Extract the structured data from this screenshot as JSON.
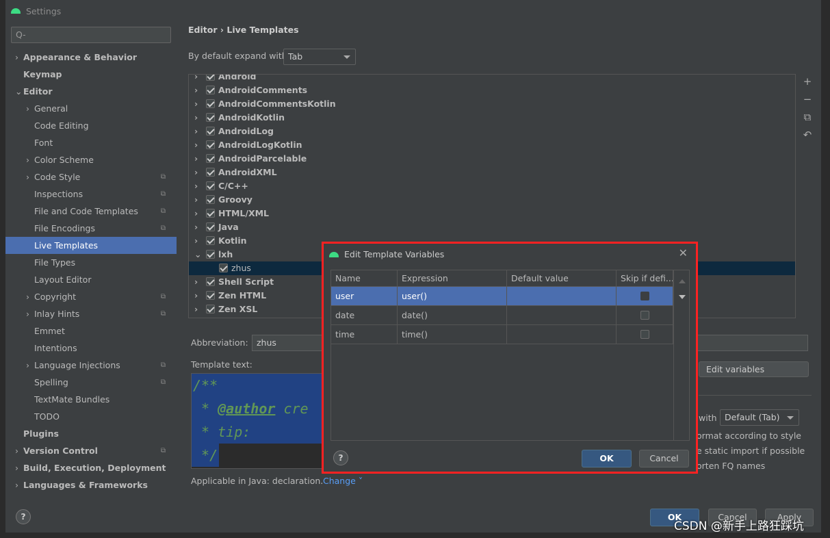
{
  "window": {
    "title": "Settings"
  },
  "search": {
    "placeholder": "Q-"
  },
  "sidebar": {
    "items": [
      {
        "label": "Appearance & Behavior",
        "level": 0,
        "bold": true,
        "chevron": "right"
      },
      {
        "label": "Keymap",
        "level": 0,
        "bold": true
      },
      {
        "label": "Editor",
        "level": 0,
        "bold": true,
        "chevron": "down"
      },
      {
        "label": "General",
        "level": 1,
        "chevron": "right"
      },
      {
        "label": "Code Editing",
        "level": 1
      },
      {
        "label": "Font",
        "level": 1
      },
      {
        "label": "Color Scheme",
        "level": 1,
        "chevron": "right"
      },
      {
        "label": "Code Style",
        "level": 1,
        "chevron": "right",
        "copy": true
      },
      {
        "label": "Inspections",
        "level": 1,
        "copy": true
      },
      {
        "label": "File and Code Templates",
        "level": 1,
        "copy": true
      },
      {
        "label": "File Encodings",
        "level": 1,
        "copy": true
      },
      {
        "label": "Live Templates",
        "level": 1,
        "selected": true
      },
      {
        "label": "File Types",
        "level": 1
      },
      {
        "label": "Layout Editor",
        "level": 1
      },
      {
        "label": "Copyright",
        "level": 1,
        "chevron": "right",
        "copy": true
      },
      {
        "label": "Inlay Hints",
        "level": 1,
        "chevron": "right",
        "copy": true
      },
      {
        "label": "Emmet",
        "level": 1
      },
      {
        "label": "Intentions",
        "level": 1
      },
      {
        "label": "Language Injections",
        "level": 1,
        "chevron": "right",
        "copy": true
      },
      {
        "label": "Spelling",
        "level": 1,
        "copy": true
      },
      {
        "label": "TextMate Bundles",
        "level": 1
      },
      {
        "label": "TODO",
        "level": 1
      },
      {
        "label": "Plugins",
        "level": 0,
        "bold": true
      },
      {
        "label": "Version Control",
        "level": 0,
        "bold": true,
        "chevron": "right",
        "copy": true
      },
      {
        "label": "Build, Execution, Deployment",
        "level": 0,
        "bold": true,
        "chevron": "right"
      },
      {
        "label": "Languages & Frameworks",
        "level": 0,
        "bold": true,
        "chevron": "right"
      }
    ]
  },
  "breadcrumb": {
    "parent": "Editor",
    "sep": "›",
    "current": "Live Templates"
  },
  "expand": {
    "label": "By default expand with",
    "value": "Tab"
  },
  "tree": [
    {
      "label": "Android",
      "chevron": "right"
    },
    {
      "label": "AndroidComments",
      "chevron": "right"
    },
    {
      "label": "AndroidCommentsKotlin",
      "chevron": "right"
    },
    {
      "label": "AndroidKotlin",
      "chevron": "right"
    },
    {
      "label": "AndroidLog",
      "chevron": "right"
    },
    {
      "label": "AndroidLogKotlin",
      "chevron": "right"
    },
    {
      "label": "AndroidParcelable",
      "chevron": "right"
    },
    {
      "label": "AndroidXML",
      "chevron": "right"
    },
    {
      "label": "C/C++",
      "chevron": "right"
    },
    {
      "label": "Groovy",
      "chevron": "right"
    },
    {
      "label": "HTML/XML",
      "chevron": "right"
    },
    {
      "label": "Java",
      "chevron": "right"
    },
    {
      "label": "Kotlin",
      "chevron": "right"
    },
    {
      "label": "lxh",
      "chevron": "down"
    },
    {
      "label": "zhus",
      "child": true,
      "selected": true
    },
    {
      "label": "Shell Script",
      "chevron": "right"
    },
    {
      "label": "Zen HTML",
      "chevron": "right"
    },
    {
      "label": "Zen XSL",
      "chevron": "right"
    }
  ],
  "tools": [
    "+",
    "−",
    "⧉",
    "↶"
  ],
  "abbreviation": {
    "label": "Abbreviation:",
    "value": "zhus"
  },
  "template": {
    "label": "Template text:",
    "lines": [
      "/**",
      " * ",
      "@author",
      " cre",
      " * tip:",
      " */"
    ]
  },
  "applicable": {
    "text": "Applicable in Java: declaration.",
    "change": "Change"
  },
  "options": {
    "edit_variables": "Edit variables",
    "expand_with": "with",
    "expand_value": "Default (Tab)",
    "reformat": "ormat according to style",
    "static_import": "e static import if possible",
    "shorten": "orten FQ names"
  },
  "buttons": {
    "ok": "OK",
    "cancel": "Cancel",
    "apply": "Apply",
    "help": "?"
  },
  "dialog": {
    "title": "Edit Template Variables",
    "close": "✕",
    "columns": [
      "Name",
      "Expression",
      "Default value",
      "Skip if defi..."
    ],
    "rows": [
      {
        "name": "user",
        "expression": "user()",
        "default": "",
        "skip": true,
        "selected": true
      },
      {
        "name": "date",
        "expression": "date()",
        "default": "",
        "skip": false
      },
      {
        "name": "time",
        "expression": "time()",
        "default": "",
        "skip": false
      }
    ],
    "ok": "OK",
    "cancel": "Cancel",
    "help": "?"
  },
  "watermark": "CSDN @新手上路狂踩坑",
  "colors": {
    "selection": "#4b6eaf",
    "highlight_border": "#ff2222",
    "primary_button": "#365880",
    "link": "#589df6"
  }
}
